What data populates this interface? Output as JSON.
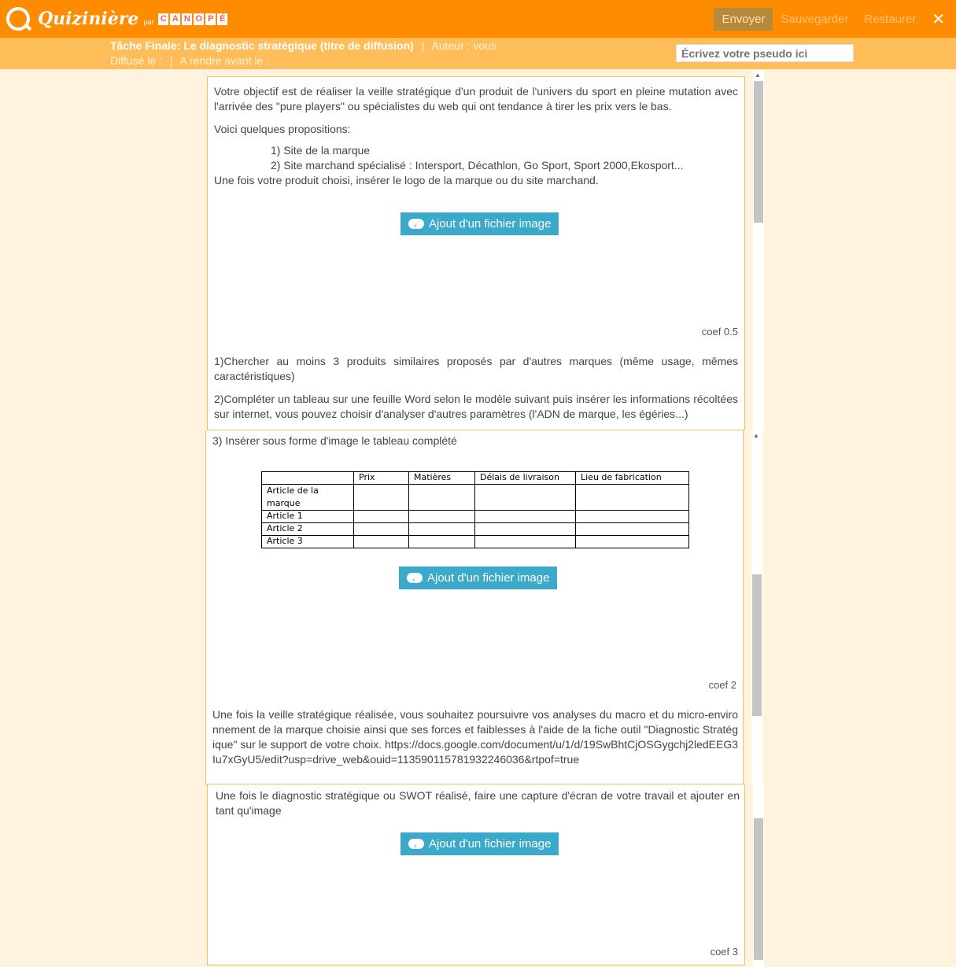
{
  "header": {
    "logo_text": "Quizinière",
    "logo_par": "par",
    "canope_letters": [
      "C",
      "A",
      "N",
      "O",
      "P",
      "É"
    ],
    "envoyer": "Envoyer",
    "sauvegarder": "Sauvegarder",
    "restaurer": "Restaurer",
    "close": "✕"
  },
  "task": {
    "title": "Tâche Finale: Le diagnostic stratégique (titre de diffusion)",
    "sep": "|",
    "author": "Auteur : vous",
    "diffuse": "Diffusé le :",
    "sep2": "|",
    "due": "A rendre avant le :",
    "pseudo_placeholder": "Écrivez votre pseudo ici"
  },
  "panel1": {
    "intro": "Votre objectif est de réaliser la veille stratégique d'un produit de l'univers du sport en pleine mutation avec l'arrivée des \"pure players\" ou spécialistes du web qui ont tendance à tirer les prix vers le bas.",
    "props": "Voici quelques propositions:",
    "item1": "1)  Site de la marque",
    "item2": "2) Site marchand spécialisé  : Intersport, Décathlon, Go Sport, Sport 2000,Ekosport...",
    "choose": "Une fois votre produit choisi, insérer le logo de la marque ou du site marchand.",
    "upload": "Ajout d'un fichier image",
    "coef": "coef 0.5",
    "q1": "1)Chercher au moins 3 produits similaires proposés par d'autres marques (même usage, mêmes caractéristiques)",
    "q2": "2)Compléter un tableau sur une feuille Word selon le modèle suivant puis insérer les informations récoltées sur internet, vous pouvez choisir d'analyser d'autres paramètres (l'ADN de marque, les égéries...)"
  },
  "panel2": {
    "q3": "3) Insérer sous forme d'image le tableau complété",
    "table_headers": [
      "",
      "Prix",
      "Matières",
      "Délais de livraison",
      "Lieu de fabrication"
    ],
    "table_rows": [
      "Article de la marque",
      "Article 1",
      "Article 2",
      "Article 3"
    ],
    "upload": "Ajout d'un fichier image",
    "coef": "coef 2",
    "text": "Une fois la veille stratégique réalisée, vous souhaitez poursuivre vos analyses du macro et du micro-environnement de la marque choisie ainsi que ses forces et faiblesses à l'aide de la fiche outil \"Diagnostic Stratégique\" sur le support de votre choix. https://docs.google.com/document/u/1/d/19SwBhtCjOSGygchj2ledEEG3Iu7xGyU5/edit?usp=drive_web&ouid=113590115781932246036&rtpof=true"
  },
  "panel3": {
    "text": "Une fois le diagnostic stratégique ou SWOT réalisé, faire une capture d'écran de votre travail et ajouter en tant qu'image",
    "upload": "Ajout d'un fichier image",
    "coef": "coef 3"
  },
  "colors": {
    "topbar": "#ff8c00",
    "subbar": "#ffbd5a",
    "background": "#fff3e0",
    "upload_button": "#3ba9c9",
    "panel_border": "#f2c15a"
  }
}
